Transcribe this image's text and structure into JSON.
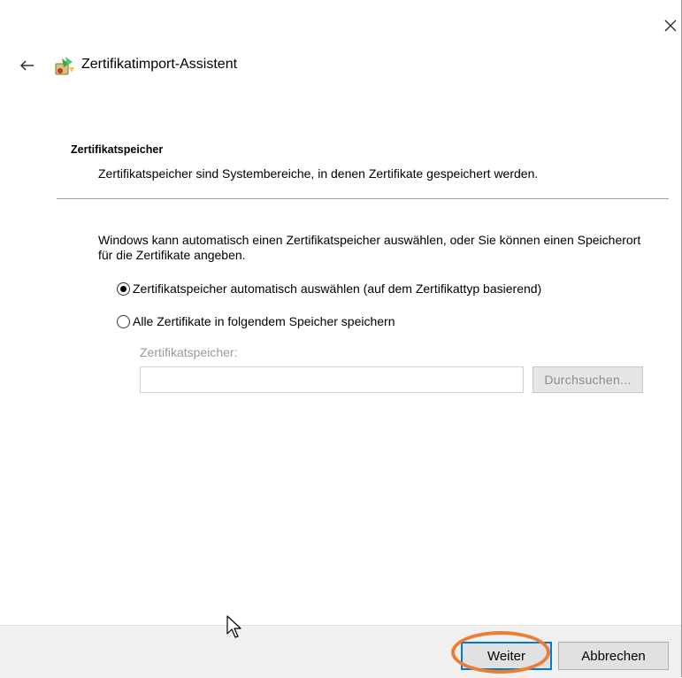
{
  "window": {
    "title": "Zertifikatimport-Assistent"
  },
  "section": {
    "title": "Zertifikatspeicher",
    "description": "Zertifikatspeicher sind Systembereiche, in denen Zertifikate gespeichert werden."
  },
  "intro": "Windows kann automatisch einen Zertifikatspeicher auswählen, oder Sie können einen Speicherort für die Zertifikate angeben.",
  "options": {
    "auto": {
      "label": "Zertifikatspeicher automatisch auswählen (auf dem Zertifikattyp basierend)",
      "selected": true
    },
    "manual": {
      "label": "Alle Zertifikate in folgendem Speicher speichern",
      "selected": false
    }
  },
  "store": {
    "label": "Zertifikatspeicher:",
    "value": "",
    "browse_label": "Durchsuchen..."
  },
  "buttons": {
    "next_label": "Weiter",
    "cancel_label": "Abbrechen"
  },
  "icons": {
    "close": "close-icon",
    "back": "back-arrow-icon",
    "wizard": "certificate-wizard-icon",
    "cursor": "mouse-pointer-icon"
  },
  "colors": {
    "highlight": "#ed7d31",
    "focus": "#0078d7",
    "footer": "#f0f0f0"
  }
}
